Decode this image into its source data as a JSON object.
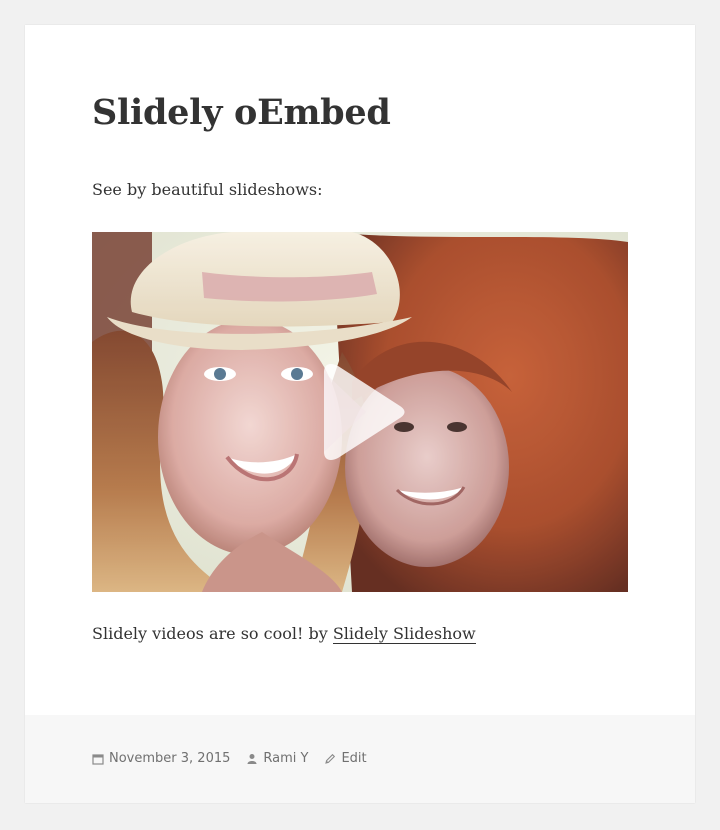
{
  "post": {
    "title": "Slidely oEmbed",
    "intro": "See by beautiful slideshows:",
    "caption_text": "Slidely videos are so cool! by ",
    "caption_link": "Slidely Slideshow"
  },
  "embed": {
    "type": "slideshow-video",
    "play_icon": "play-icon"
  },
  "footer": {
    "date": "November 3, 2015",
    "date_icon": "calendar-icon",
    "author": "Rami Y",
    "author_icon": "person-icon",
    "edit": "Edit",
    "edit_icon": "pencil-icon"
  }
}
